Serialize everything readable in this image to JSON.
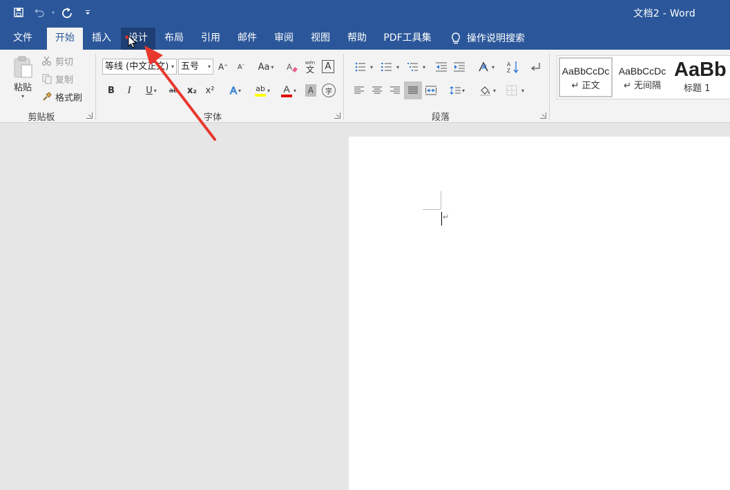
{
  "window": {
    "title": "文档2  -  Word"
  },
  "qat": {
    "save_icon": "save-icon",
    "undo_icon": "undo-icon",
    "redo_icon": "redo-icon",
    "customize_icon": "customize-icon"
  },
  "tabs": [
    {
      "label": "文件"
    },
    {
      "label": "开始"
    },
    {
      "label": "插入"
    },
    {
      "label": "设计"
    },
    {
      "label": "布局"
    },
    {
      "label": "引用"
    },
    {
      "label": "邮件"
    },
    {
      "label": "审阅"
    },
    {
      "label": "视图"
    },
    {
      "label": "帮助"
    },
    {
      "label": "PDF工具集"
    },
    {
      "label": "操作说明搜索"
    }
  ],
  "clipboard": {
    "paste": "粘贴",
    "cut": "剪切",
    "copy": "复制",
    "format_painter": "格式刷",
    "group": "剪贴板"
  },
  "font": {
    "name": "等线 (中文正文)",
    "size": "五号",
    "group": "字体",
    "grow": "A",
    "shrink": "A",
    "change_case": "Aa",
    "bold": "B",
    "italic": "I",
    "underline": "U",
    "strike": "ab",
    "subscript": "x₂",
    "superscript": "x²",
    "font_color_letter": "A",
    "highlight_letters": "ab",
    "char_border": "A",
    "shading": "A",
    "phonetic_top": "wén",
    "phonetic_bottom": "文",
    "enclose": "字"
  },
  "paragraph": {
    "group": "段落"
  },
  "styles": [
    {
      "sample": "AaBbCcDc",
      "name": "↵ 正文"
    },
    {
      "sample": "AaBbCcDc",
      "name": "↵ 无间隔"
    },
    {
      "sample": "AaBb",
      "name": "标题 1"
    }
  ],
  "document": {
    "paragraph_mark": "↵"
  },
  "colors": {
    "accent": "#2b579a",
    "hover_tab": "#1e3f73",
    "ribbon": "#f3f3f3",
    "canvas": "#e6e6e6",
    "annotation_arrow": "#e8382e",
    "highlight": "#ffff00",
    "font_color": "#e00000"
  }
}
